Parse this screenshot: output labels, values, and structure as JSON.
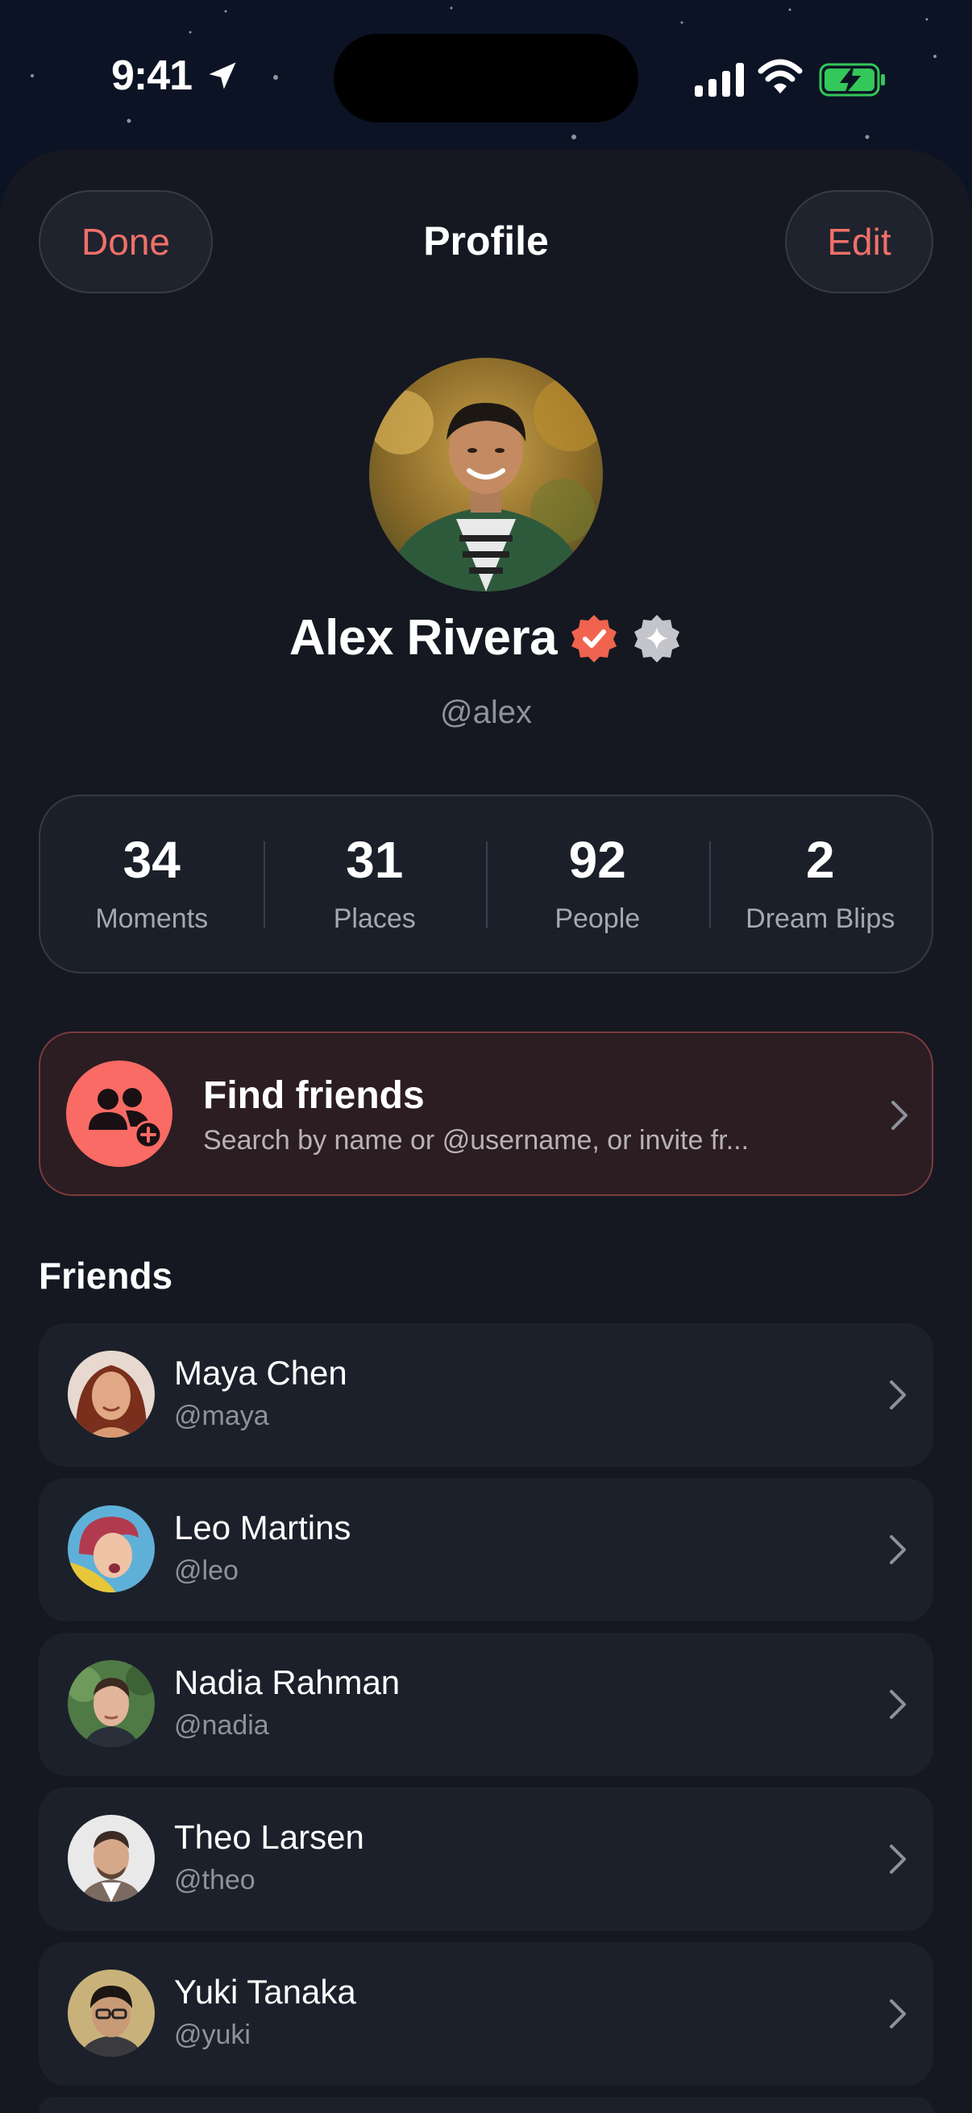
{
  "status_bar": {
    "time": "9:41"
  },
  "header": {
    "done_label": "Done",
    "title": "Profile",
    "edit_label": "Edit"
  },
  "profile": {
    "name": "Alex Rivera",
    "handle": "@alex"
  },
  "stats": [
    {
      "value": "34",
      "label": "Moments"
    },
    {
      "value": "31",
      "label": "Places"
    },
    {
      "value": "92",
      "label": "People"
    },
    {
      "value": "2",
      "label": "Dream Blips"
    }
  ],
  "find_friends": {
    "title": "Find friends",
    "subtitle": "Search by name or @username, or invite fr..."
  },
  "friends": {
    "section_title": "Friends",
    "items": [
      {
        "name": "Maya Chen",
        "handle": "@maya"
      },
      {
        "name": "Leo Martins",
        "handle": "@leo"
      },
      {
        "name": "Nadia Rahman",
        "handle": "@nadia"
      },
      {
        "name": "Theo Larsen",
        "handle": "@theo"
      },
      {
        "name": "Yuki Tanaka",
        "handle": "@yuki"
      }
    ]
  },
  "colors": {
    "accent": "#f0706a",
    "background": "#0b1324",
    "sheet": "#151821",
    "verified_badge": "#f0644f"
  }
}
